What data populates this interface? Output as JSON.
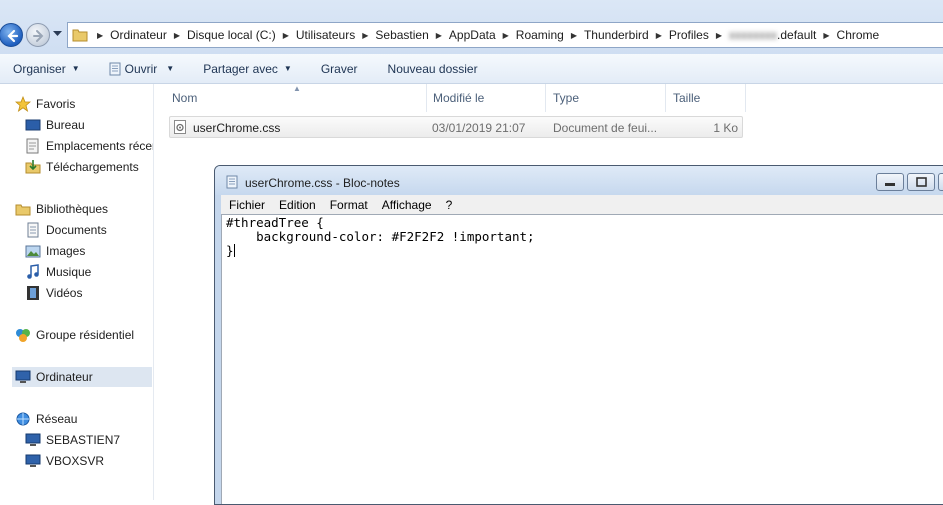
{
  "breadcrumb": {
    "segments": [
      "Ordinateur",
      "Disque local (C:)",
      "Utilisateurs",
      "Sebastien",
      "AppData",
      "Roaming",
      "Thunderbird",
      "Profiles"
    ],
    "profile_suffix": ".default",
    "last": "Chrome"
  },
  "toolbar": {
    "organize": "Organiser",
    "open": "Ouvrir",
    "share": "Partager avec",
    "burn": "Graver",
    "new_folder": "Nouveau dossier"
  },
  "navpane": {
    "favorites": "Favoris",
    "desktop": "Bureau",
    "recent_places": "Emplacements récents",
    "downloads": "Téléchargements",
    "libraries": "Bibliothèques",
    "documents": "Documents",
    "images": "Images",
    "music": "Musique",
    "videos": "Vidéos",
    "homegroup": "Groupe résidentiel",
    "computer": "Ordinateur",
    "network": "Réseau",
    "pc1": "SEBASTIEN7",
    "pc2": "VBOXSVR"
  },
  "filelist": {
    "columns": {
      "name": "Nom",
      "modified": "Modifié le",
      "type": "Type",
      "size": "Taille"
    },
    "rows": [
      {
        "name": "userChrome.css",
        "modified": "03/01/2019 21:07",
        "type": "Document de feui...",
        "size": "1 Ko"
      }
    ]
  },
  "notepad": {
    "title": "userChrome.css - Bloc-notes",
    "menu": [
      "Fichier",
      "Edition",
      "Format",
      "Affichage",
      "?"
    ],
    "lines": [
      "#threadTree {",
      "    background-color: #F2F2F2 !important;",
      "}"
    ]
  },
  "colors": {
    "selection": "#dde6f1",
    "address_bar": "#dbe7f6",
    "toolbar_text": "#1e3453"
  }
}
